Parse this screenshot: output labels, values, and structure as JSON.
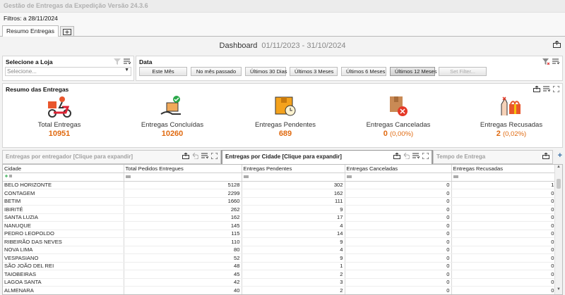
{
  "window": {
    "title": "Gestão de Entregas da Expedição Versão 24.3.6"
  },
  "filters": {
    "text": "Filtros:  a 28/11/2024"
  },
  "tabs": [
    {
      "label": "Resumo Entregas"
    }
  ],
  "dashboard": {
    "title": "Dashboard",
    "range": "01/11/2023 - 31/10/2024"
  },
  "store_panel": {
    "title": "Selecione a Loja",
    "placeholder": "Selecione..."
  },
  "date_panel": {
    "title": "Data",
    "buttons": [
      "Este Mês",
      "No mês passado",
      "Últimos 30 Dias",
      "Últimos 3 Meses",
      "Últimos 6 Meses",
      "Últimos 12 Meses",
      "Set Filter..."
    ],
    "selected": "Últimos 12 Meses"
  },
  "summary": {
    "title": "Resumo das Entregas",
    "accent": "#e06a10",
    "kpis": [
      {
        "label": "Total Entregas",
        "value": "10951",
        "pct": "",
        "icon": "delivery-scooter-icon"
      },
      {
        "label": "Entregas Concluídas",
        "value": "10260",
        "pct": "",
        "icon": "package-check-hand-icon"
      },
      {
        "label": "Entregas Pendentes",
        "value": "689",
        "pct": "",
        "icon": "package-clock-icon"
      },
      {
        "label": "Entregas Canceladas",
        "value": "0",
        "pct": "(0,00%)",
        "icon": "package-cancel-icon"
      },
      {
        "label": "Entregas Recusadas",
        "value": "2",
        "pct": "(0,02%)",
        "icon": "gift-refuse-hand-icon"
      }
    ]
  },
  "grid_tabs": [
    {
      "label": "Entregas por entregador [Clique para expandir]"
    },
    {
      "label": "Entregas por Cidade [Clique para expandir]"
    },
    {
      "label": "Tempo de Entrega"
    }
  ],
  "grid": {
    "columns": [
      "Cidade",
      "Total Pedidos Entregues",
      "Entregas Pendentes",
      "Entregas Canceladas",
      "Entregas Recusadas"
    ],
    "rows": [
      [
        "BELO HORIZONTE",
        "5128",
        "302",
        "0",
        "1"
      ],
      [
        "CONTAGEM",
        "2299",
        "162",
        "0",
        "0"
      ],
      [
        "BETIM",
        "1660",
        "111",
        "0",
        "0"
      ],
      [
        "IBIRITÉ",
        "262",
        "9",
        "0",
        "0"
      ],
      [
        "SANTA LUZIA",
        "162",
        "17",
        "0",
        "0"
      ],
      [
        "NANUQUE",
        "145",
        "4",
        "0",
        "0"
      ],
      [
        "PEDRO LEOPOLDO",
        "115",
        "14",
        "0",
        "0"
      ],
      [
        "RIBEIRÃO DAS NEVES",
        "110",
        "9",
        "0",
        "0"
      ],
      [
        "NOVA LIMA",
        "80",
        "4",
        "0",
        "0"
      ],
      [
        "VESPASIANO",
        "52",
        "9",
        "0",
        "0"
      ],
      [
        "SÃO JOÃO DEL REI",
        "48",
        "1",
        "0",
        "0"
      ],
      [
        "TAIOBEIRAS",
        "45",
        "2",
        "0",
        "0"
      ],
      [
        "LAGOA SANTA",
        "42",
        "3",
        "0",
        "0"
      ],
      [
        "ALMENARA",
        "40",
        "2",
        "0",
        "0"
      ]
    ]
  }
}
